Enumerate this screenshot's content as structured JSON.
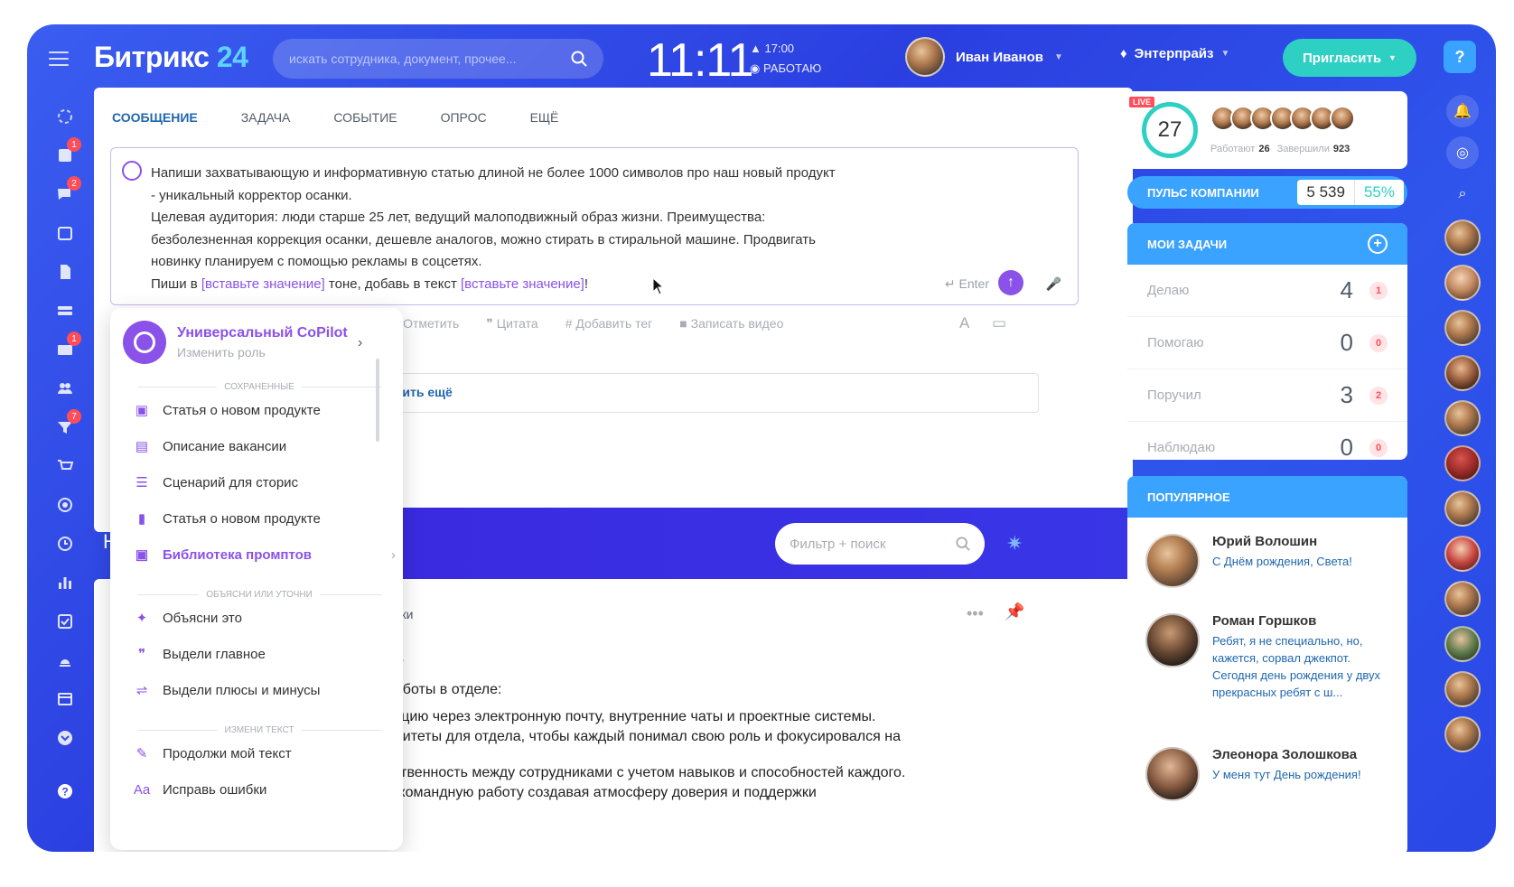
{
  "header": {
    "logo_main": "Битрикс",
    "logo_num": "24",
    "search_placeholder": "искать сотрудника, документ, прочее...",
    "clock": "11:11",
    "work_time": "17:00",
    "work_status": "РАБОТАЮ",
    "user_name": "Иван Иванов",
    "plan": "Энтерпрайз",
    "invite_label": "Пригласить",
    "help": "?"
  },
  "left_nav": {
    "badges": {
      "item2": "1",
      "item3": "2",
      "item7": "1",
      "item9": "7"
    }
  },
  "composer": {
    "tabs": [
      "СООБЩЕНИЕ",
      "ЗАДАЧА",
      "СОБЫТИЕ",
      "ОПРОС",
      "ЕЩЁ"
    ],
    "prompt_line1": "Напиши захватывающую и информативную статью длиной не более 1000 символов про наш новый продукт",
    "prompt_line2": " - уникальный корректор осанки.",
    "prompt_line3": "Целевая аудитория: люди старше 25 лет, ведущий малоподвижный образ жизни. Преимущества:",
    "prompt_line4": "безболезненная коррекция осанки, дешевле аналогов, можно стирать в стиральной машине. Продвигать",
    "prompt_line5": "новинку планируем с помощью рекламы в соцсетях.",
    "prompt_line6_a": "Пиши в ",
    "prompt_placeholder1": "[вставьте значение]",
    "prompt_line6_b": " тоне, добавь в текст ",
    "prompt_placeholder2": "[вставьте значение]",
    "prompt_line6_c": "!",
    "enter_hint": "Enter",
    "tools": [
      "Отметить",
      "Цитата",
      "Добавить тег",
      "Записать видео"
    ],
    "add_more": "авить ещё"
  },
  "copilot_menu": {
    "title": "Универсальный CoPilot",
    "subtitle": "Изменить роль",
    "section_saved": "сохраненные",
    "saved": [
      "Статья о новом продукте",
      "Описание вакансии",
      "Сценарий для сторис",
      "Статья о новом продукте"
    ],
    "library": "Библиотека промптов",
    "section_explain": "объясни или уточни",
    "explain": [
      "Объясни это",
      "Выдели главное",
      "Выдели плюсы и минусы"
    ],
    "section_change": "измени текст",
    "change": [
      "Продолжи мой текст",
      "Исправь ошибки"
    ]
  },
  "feed": {
    "filter_placeholder": "Фильтр + поиск",
    "post_lines": [
      "ники",
      "ле",
      "работы в отделе:",
      "кацию через электронную почту, внутренние чаты и проектные системы.",
      "оритеты для отдела, чтобы каждый понимал свою роль и фокусировался на",
      "тственность между сотрудниками с учетом навыков и способностей каждого.",
      "и командную работу создавая атмосферу доверия и поддержки"
    ]
  },
  "live": {
    "tag": "LIVE",
    "count": "27",
    "working_label": "Работают",
    "working": "26",
    "done_label": "Завершили",
    "done": "923"
  },
  "pulse": {
    "label": "ПУЛЬС КОМПАНИИ",
    "value": "5 539",
    "percent": "55%"
  },
  "tasks": {
    "title": "МОИ ЗАДАЧИ",
    "rows": [
      {
        "label": "Делаю",
        "count": "4",
        "badge": "1"
      },
      {
        "label": "Помогаю",
        "count": "0",
        "badge": "0"
      },
      {
        "label": "Поручил",
        "count": "3",
        "badge": "2"
      },
      {
        "label": "Наблюдаю",
        "count": "0",
        "badge": "0"
      }
    ]
  },
  "popular": {
    "title": "ПОПУЛЯРНОЕ",
    "posts": [
      {
        "name": "Юрий Волошин",
        "text": "С Днём рождения, Света!"
      },
      {
        "name": "Роман Горшков",
        "text": "Ребят, я не специально, но, кажется, сорвал джекпот. Сегодня день рождения у двух прекрасных ребят с ш..."
      },
      {
        "name": "Элеонора Золошкова",
        "text": "У меня тут День рождения!"
      }
    ]
  },
  "colors": {
    "accent": "#2067b0",
    "copilot": "#8a52e8",
    "teal": "#2ed0c4",
    "sky": "#3aa2ff",
    "badge": "#ff4d5a"
  }
}
